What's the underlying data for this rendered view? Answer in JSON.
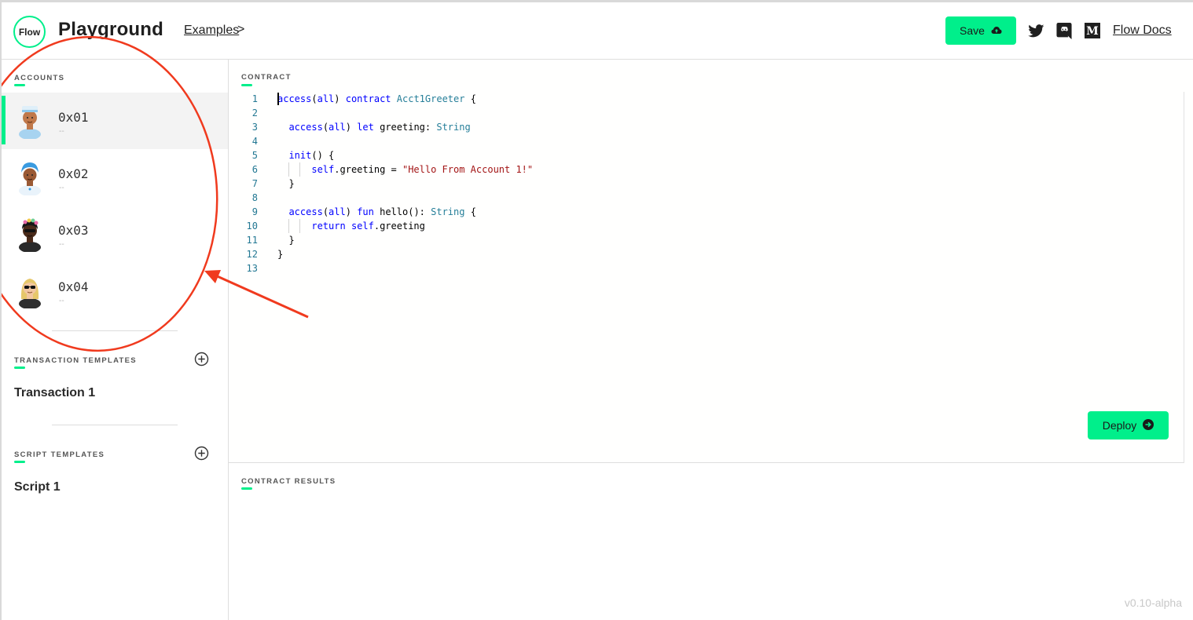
{
  "header": {
    "logo_text": "Flow",
    "title": "Playground",
    "examples_label": "Examples",
    "examples_chevron": ">",
    "save_label": "Save",
    "docs_label": "Flow Docs",
    "icons": [
      "cloud-upload-icon",
      "twitter-icon",
      "discord-icon",
      "medium-icon"
    ],
    "accent_color": "#00ef8b"
  },
  "sidebar": {
    "accounts_label": "ACCOUNTS",
    "accounts": [
      {
        "address": "0x01",
        "subtitle": "--",
        "selected": true
      },
      {
        "address": "0x02",
        "subtitle": "--",
        "selected": false
      },
      {
        "address": "0x03",
        "subtitle": "--",
        "selected": false
      },
      {
        "address": "0x04",
        "subtitle": "--",
        "selected": false
      }
    ],
    "transactions_label": "TRANSACTION TEMPLATES",
    "transactions": [
      "Transaction 1"
    ],
    "scripts_label": "SCRIPT TEMPLATES",
    "scripts": [
      "Script 1"
    ]
  },
  "editor": {
    "label": "CONTRACT",
    "lines": [
      {
        "n": "1",
        "tokens": [
          [
            "kw",
            "access"
          ],
          [
            "pl",
            "("
          ],
          [
            "kw",
            "all"
          ],
          [
            "pl",
            ") "
          ],
          [
            "kw",
            "contract"
          ],
          [
            "pl",
            " "
          ],
          [
            "ty",
            "Acct1Greeter"
          ],
          [
            "pl",
            " {"
          ]
        ]
      },
      {
        "n": "2",
        "tokens": []
      },
      {
        "n": "3",
        "tokens": [
          [
            "pl",
            "  "
          ],
          [
            "kw",
            "access"
          ],
          [
            "pl",
            "("
          ],
          [
            "kw",
            "all"
          ],
          [
            "pl",
            ") "
          ],
          [
            "kw",
            "let"
          ],
          [
            "pl",
            " greeting: "
          ],
          [
            "ty",
            "String"
          ]
        ]
      },
      {
        "n": "4",
        "tokens": []
      },
      {
        "n": "5",
        "tokens": [
          [
            "pl",
            "  "
          ],
          [
            "kw",
            "init"
          ],
          [
            "pl",
            "() {"
          ]
        ]
      },
      {
        "n": "6",
        "tokens": [
          [
            "pl",
            "      "
          ],
          [
            "kw",
            "self"
          ],
          [
            "pl",
            ".greeting = "
          ],
          [
            "str",
            "\"Hello From Account 1!\""
          ]
        ]
      },
      {
        "n": "7",
        "tokens": [
          [
            "pl",
            "  }"
          ]
        ]
      },
      {
        "n": "8",
        "tokens": []
      },
      {
        "n": "9",
        "tokens": [
          [
            "pl",
            "  "
          ],
          [
            "kw",
            "access"
          ],
          [
            "pl",
            "("
          ],
          [
            "kw",
            "all"
          ],
          [
            "pl",
            ") "
          ],
          [
            "kw",
            "fun"
          ],
          [
            "pl",
            " hello(): "
          ],
          [
            "ty",
            "String"
          ],
          [
            "pl",
            " {"
          ]
        ]
      },
      {
        "n": "10",
        "tokens": [
          [
            "pl",
            "      "
          ],
          [
            "kw",
            "return"
          ],
          [
            "pl",
            " "
          ],
          [
            "kw",
            "self"
          ],
          [
            "pl",
            ".greeting"
          ]
        ]
      },
      {
        "n": "11",
        "tokens": [
          [
            "pl",
            "  }"
          ]
        ]
      },
      {
        "n": "12",
        "tokens": [
          [
            "pl",
            "}"
          ]
        ]
      },
      {
        "n": "13",
        "tokens": []
      }
    ],
    "deploy_label": "Deploy"
  },
  "results": {
    "label": "CONTRACT RESULTS"
  },
  "version": "v0.10-alpha",
  "annotation_color": "#f03a1e"
}
